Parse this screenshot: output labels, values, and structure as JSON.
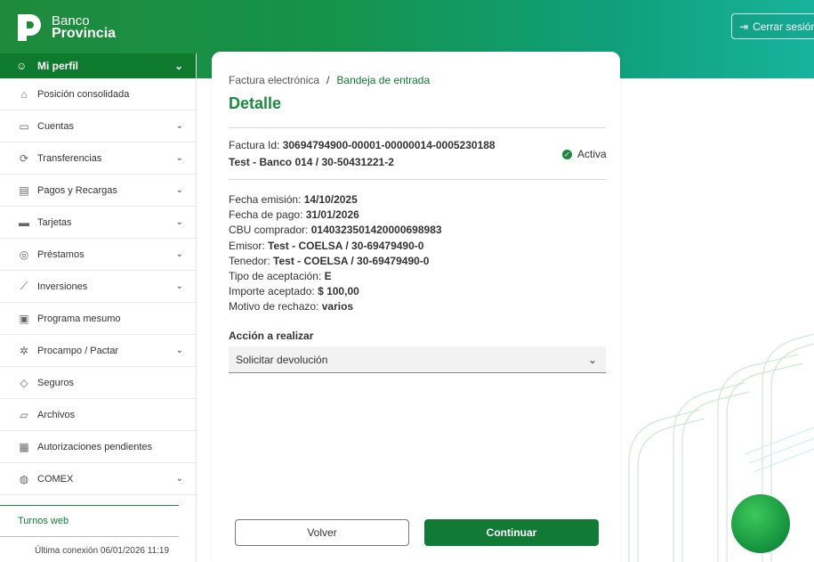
{
  "brand": {
    "line1": "Banco",
    "line2": "Provincia"
  },
  "header": {
    "logout_label": "Cerrar sesión"
  },
  "sidebar": {
    "profile_label": "Mi perfil",
    "items": [
      {
        "label": "Posición consolidada",
        "icon": "home-icon",
        "has_chevron": false
      },
      {
        "label": "Cuentas",
        "icon": "wallet-icon",
        "has_chevron": true
      },
      {
        "label": "Transferencias",
        "icon": "transfer-icon",
        "has_chevron": true
      },
      {
        "label": "Pagos y Recargas",
        "icon": "receipt-icon",
        "has_chevron": true
      },
      {
        "label": "Tarjetas",
        "icon": "card-icon",
        "has_chevron": true
      },
      {
        "label": "Préstamos",
        "icon": "loan-icon",
        "has_chevron": true
      },
      {
        "label": "Inversiones",
        "icon": "chart-icon",
        "has_chevron": true
      },
      {
        "label": "Programa mesumo",
        "icon": "gift-icon",
        "has_chevron": false
      },
      {
        "label": "Procampo / Pactar",
        "icon": "wheat-icon",
        "has_chevron": true
      },
      {
        "label": "Seguros",
        "icon": "shield-icon",
        "has_chevron": false
      },
      {
        "label": "Archivos",
        "icon": "folder-icon",
        "has_chevron": false
      },
      {
        "label": "Autorizaciones pendientes",
        "icon": "document-icon",
        "has_chevron": false
      },
      {
        "label": "COMEX",
        "icon": "globe-icon",
        "has_chevron": true
      }
    ],
    "turnos_label": "Turnos web",
    "last_connection": "Última conexión 06/01/2026 11:19"
  },
  "breadcrumb": {
    "parent": "Factura electrónica",
    "separator": "/",
    "current": "Bandeja de entrada"
  },
  "page_title": "Detalle",
  "invoice": {
    "id_label": "Factura Id:",
    "id_value": "30694794900-00001-00000014-0005230188",
    "subtitle": "Test - Banco 014 / 30-50431221-2",
    "status": "Activa"
  },
  "details": [
    {
      "label": "Fecha emisión:",
      "value": "14/10/2025"
    },
    {
      "label": "Fecha de pago:",
      "value": "31/01/2026"
    },
    {
      "label": "CBU comprador:",
      "value": "0140323501420000698983"
    },
    {
      "label": "Emisor:",
      "value": "Test - COELSA / 30-69479490-0"
    },
    {
      "label": "Tenedor:",
      "value": "Test - COELSA / 30-69479490-0"
    },
    {
      "label": "Tipo de aceptación:",
      "value": "E"
    },
    {
      "label": "Importe aceptado:",
      "value": "$ 100,00"
    },
    {
      "label": "Motivo de rechazo:",
      "value": "varios"
    }
  ],
  "action": {
    "label": "Acción a realizar",
    "selected": "Solicitar devolución"
  },
  "buttons": {
    "back": "Volver",
    "next": "Continuar"
  },
  "colors": {
    "brand_green": "#117a34",
    "accent_green": "#1a8a3c",
    "teal": "#17b39c"
  }
}
